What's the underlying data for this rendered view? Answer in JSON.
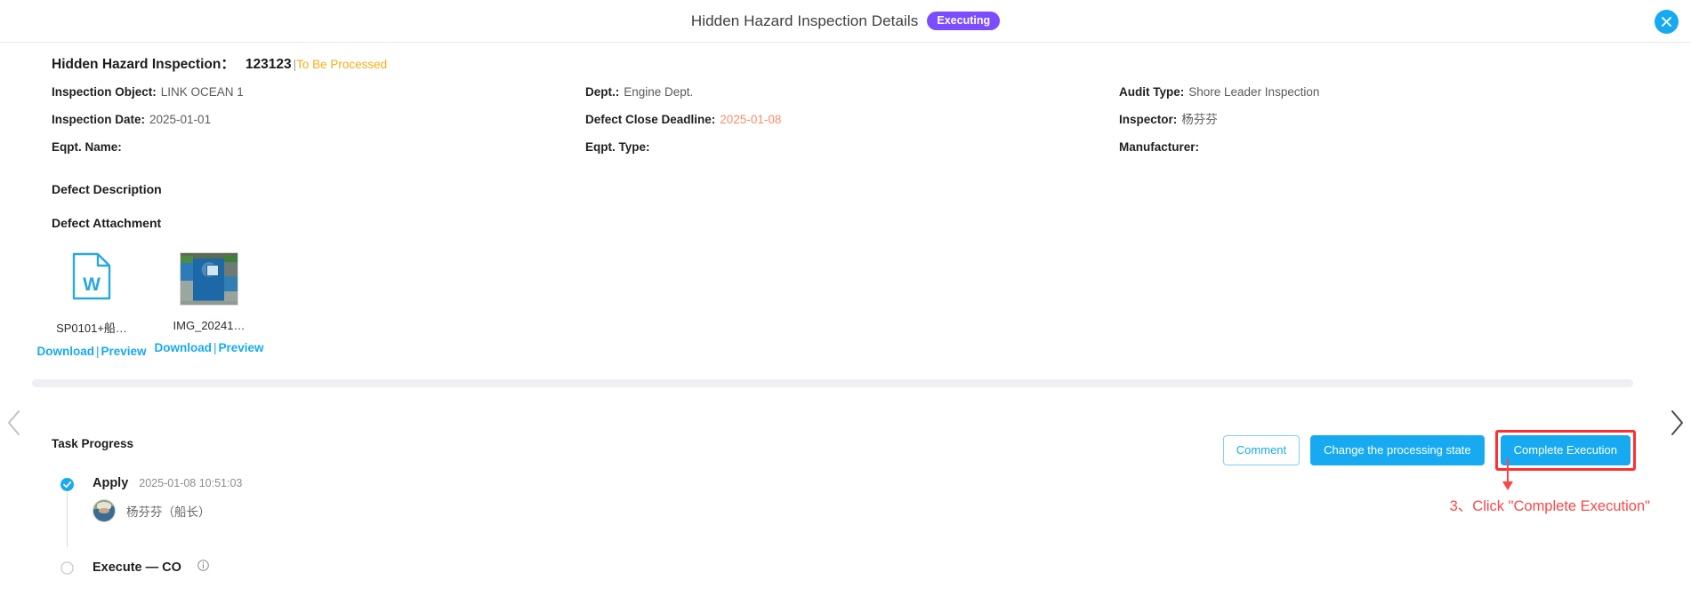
{
  "header": {
    "title": "Hidden Hazard Inspection Details",
    "status_badge": "Executing",
    "status_badge_color": "#7c4dff",
    "close_icon": "close-icon"
  },
  "headline": {
    "label": "Hidden Hazard Inspection：",
    "code": "123123",
    "separator": "|",
    "state": "To Be Processed",
    "state_color": "#faad14"
  },
  "info": {
    "rows": [
      [
        {
          "key": "Inspection Object:",
          "value": "LINK OCEAN 1",
          "warn": false
        },
        {
          "key": "Dept.:",
          "value": "Engine Dept.",
          "warn": false
        },
        {
          "key": "Audit Type:",
          "value": "Shore Leader Inspection",
          "warn": false
        }
      ],
      [
        {
          "key": "Inspection Date:",
          "value": "2025-01-01",
          "warn": false
        },
        {
          "key": "Defect Close Deadline:",
          "value": "2025-01-08",
          "warn": true
        },
        {
          "key": "Inspector:",
          "value": "杨芬芬",
          "warn": false
        }
      ],
      [
        {
          "key": "Eqpt. Name:",
          "value": "",
          "warn": false
        },
        {
          "key": "Eqpt. Type:",
          "value": "",
          "warn": false
        },
        {
          "key": "Manufacturer:",
          "value": "",
          "warn": false
        }
      ]
    ]
  },
  "sections": {
    "defect_description": "Defect Description",
    "defect_attachment": "Defect Attachment"
  },
  "attachments": {
    "items": [
      {
        "name": "SP0101+船…",
        "type": "word-document",
        "icon": "word-file-icon",
        "download_label": "Download",
        "separator": "|",
        "preview_label": "Preview"
      },
      {
        "name": "IMG_20241…",
        "type": "image",
        "icon": "image-thumbnail",
        "download_label": "Download",
        "separator": "|",
        "preview_label": "Preview"
      }
    ]
  },
  "nav": {
    "prev_icon": "chevron-left-icon",
    "next_icon": "chevron-right-icon",
    "scrollbar": "horizontal-scrollbar"
  },
  "task_progress": {
    "title": "Task Progress",
    "steps": [
      {
        "name": "Apply",
        "timestamp": "2025-01-08 10:51:03",
        "person": "杨芬芬（船长）",
        "state": "completed"
      },
      {
        "name": "Execute — CO",
        "timestamp": "",
        "person": "",
        "state": "pending",
        "info_icon": "info-circle-icon"
      }
    ]
  },
  "actions": {
    "comment_label": "Comment",
    "change_state_label": "Change the processing state",
    "complete_label": "Complete Execution",
    "primary_color": "#17aaf0",
    "highlight_color": "#ff2f2f"
  },
  "annotation": {
    "text": "3、Click \"Complete Execution\"",
    "color": "#ff4545"
  }
}
